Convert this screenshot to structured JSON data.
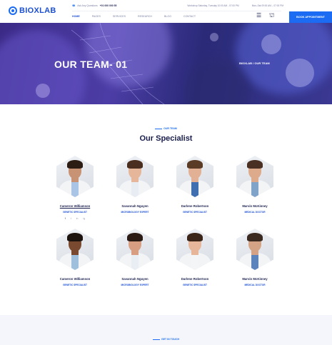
{
  "brand": {
    "name": "BIOXLAB",
    "accent": "#1b6cf2"
  },
  "topbar": {
    "call_label": "Ask Any Questions",
    "phone": "+01 000 000 55",
    "address": "Workshop Saturday, Tuesday 10:00 AM - 07:00 PM",
    "hours": "Mon–Sat 09:00 AM – 07:00 PM"
  },
  "nav": {
    "items": [
      "HOME",
      "PAGES",
      "SERVICES",
      "RESEARCH",
      "BLOG",
      "CONTACT"
    ]
  },
  "header_icons": [
    "menu-icon",
    "cart-icon"
  ],
  "appointment_label": "BOOK APPOINTMENT",
  "hero": {
    "title": "OUR TEAM- 01",
    "breadcrumb": "BIOXLAB / OUR TEAM"
  },
  "section": {
    "eyebrow": "OUR TEAM",
    "title": "Our Specialist"
  },
  "team": [
    {
      "name": "Cameron Williamson",
      "role": "GENETIC SPECIALIST",
      "skin": "#c89274",
      "hair": "#2b1d14",
      "shirt": "#a9c4e4"
    },
    {
      "name": "Savannah Nguyen",
      "role": "MICROBIOLOGY EXPERT",
      "skin": "#e6b69a",
      "hair": "#4a2e20",
      "shirt": "#e7edf3"
    },
    {
      "name": "Darlene Robertson",
      "role": "GENETIC SPECIALIST",
      "skin": "#e2b094",
      "hair": "#5a3b26",
      "shirt": "#3f6fb0"
    },
    {
      "name": "Marvin McKinney",
      "role": "MEDICAL DOCTOR",
      "skin": "#ddaa8c",
      "hair": "#4a3022",
      "shirt": "#7fa3c9"
    },
    {
      "name": "Cameron Williamson",
      "role": "GENETIC SPECIALIST",
      "skin": "#7a4a30",
      "hair": "#1c130e",
      "shirt": "#9fc0dd"
    },
    {
      "name": "Savannah Nguyen",
      "role": "MICROBIOLOGY EXPERT",
      "skin": "#d89e82",
      "hair": "#2a1b14",
      "shirt": "#e9eef4"
    },
    {
      "name": "Darlene Robertson",
      "role": "GENETIC SPECIALIST",
      "skin": "#e6b59a",
      "hair": "#3b2518",
      "shirt": "#f4f5f7"
    },
    {
      "name": "Marvin McKinney",
      "role": "MEDICAL DOCTOR",
      "skin": "#d4a386",
      "hair": "#3a2a20",
      "shirt": "#5b84bd"
    }
  ],
  "socials": [
    "f",
    "t",
    "in",
    "ig"
  ],
  "footer": {
    "eyebrow": "GET IN TOUCH"
  }
}
